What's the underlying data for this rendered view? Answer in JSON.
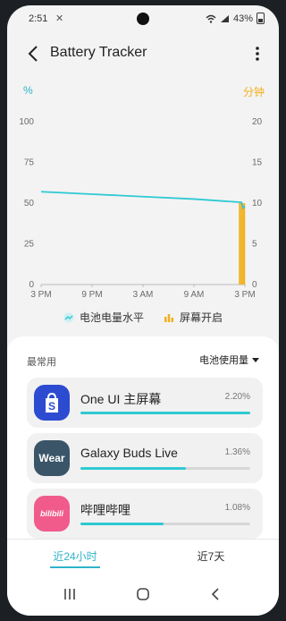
{
  "status_bar": {
    "time": "2:51",
    "notification_glyph": "✕",
    "battery_percent": "43%"
  },
  "header": {
    "title": "Battery Tracker"
  },
  "chart": {
    "left_unit": "%",
    "right_unit": "分钟",
    "colors": {
      "battery": "#2fc9d3",
      "screen": "#f2b01e"
    }
  },
  "chart_data": {
    "type": "line",
    "x_ticks": [
      "3 PM",
      "9 PM",
      "3 AM",
      "9 AM",
      "3 PM"
    ],
    "y_left_ticks": [
      "100",
      "75",
      "50",
      "25",
      "0"
    ],
    "y_right_ticks": [
      "20",
      "15",
      "10",
      "5",
      "0"
    ],
    "ylim_left": [
      0,
      100
    ],
    "ylim_right": [
      0,
      20
    ],
    "xlim_hours": [
      0,
      24
    ],
    "series": [
      {
        "name": "电池电量水平",
        "axis": "left",
        "kind": "line",
        "x": [
          0,
          6,
          12,
          18,
          23.6,
          23.8,
          24
        ],
        "y": [
          57,
          55.5,
          54,
          52.5,
          50.5,
          47,
          48
        ]
      },
      {
        "name": "屏幕开启",
        "axis": "right",
        "kind": "bar",
        "x": [
          23.4,
          23.65,
          23.9
        ],
        "y": [
          10,
          10,
          10
        ]
      }
    ],
    "legend_position": "bottom",
    "grid": false
  },
  "legend": [
    {
      "label": "电池电量水平"
    },
    {
      "label": "屏幕开启"
    }
  ],
  "usage": {
    "section_title": "最常用",
    "sort_label": "电池使用量",
    "apps": [
      {
        "name": "One UI 主屏幕",
        "percent": "2.20%",
        "fill": 1.0,
        "icon_text": "S",
        "icon_color": "#2c4bd1"
      },
      {
        "name": "Galaxy Buds Live",
        "percent": "1.36%",
        "fill": 0.62,
        "icon_text": "Wear",
        "icon_color": "#3b5568"
      },
      {
        "name": "哔哩哔哩",
        "percent": "1.08%",
        "fill": 0.49,
        "icon_text": "bilibili",
        "icon_color": "#f05b8b"
      }
    ]
  },
  "tabs": [
    {
      "label": "近24小时",
      "active": true
    },
    {
      "label": "近7天",
      "active": false
    }
  ]
}
